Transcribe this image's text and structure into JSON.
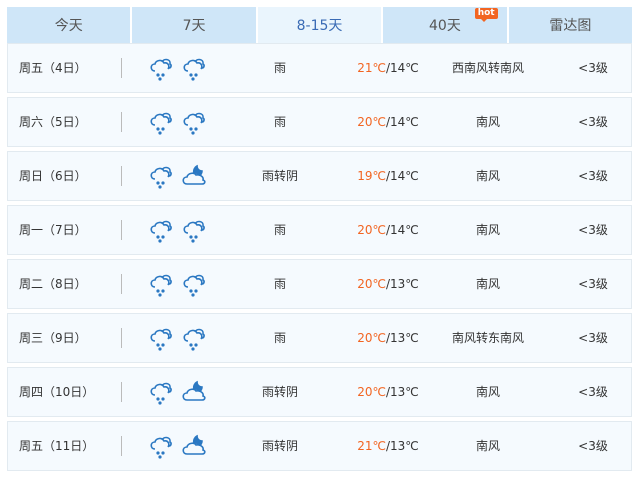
{
  "tabs": [
    {
      "label": "今天"
    },
    {
      "label": "7天"
    },
    {
      "label": "8-15天",
      "active": true
    },
    {
      "label": "40天",
      "badge": "hot"
    },
    {
      "label": "雷达图"
    }
  ],
  "colors": {
    "accent": "#3a6bb5",
    "high_temp": "#f26522",
    "icon": "#2b78c2"
  },
  "days": [
    {
      "date": "周五（4日）",
      "icons": [
        "rain-icon",
        "rain-icon"
      ],
      "weather": "雨",
      "high": "21℃",
      "low": "/14℃",
      "wind": "西南风转南风",
      "level": "<3级"
    },
    {
      "date": "周六（5日）",
      "icons": [
        "rain-icon",
        "rain-icon"
      ],
      "weather": "雨",
      "high": "20℃",
      "low": "/14℃",
      "wind": "南风",
      "level": "<3级"
    },
    {
      "date": "周日（6日）",
      "icons": [
        "rain-icon",
        "cloudy-night-icon"
      ],
      "weather": "雨转阴",
      "high": "19℃",
      "low": "/14℃",
      "wind": "南风",
      "level": "<3级"
    },
    {
      "date": "周一（7日）",
      "icons": [
        "rain-icon",
        "rain-icon"
      ],
      "weather": "雨",
      "high": "20℃",
      "low": "/14℃",
      "wind": "南风",
      "level": "<3级"
    },
    {
      "date": "周二（8日）",
      "icons": [
        "rain-icon",
        "rain-icon"
      ],
      "weather": "雨",
      "high": "20℃",
      "low": "/13℃",
      "wind": "南风",
      "level": "<3级"
    },
    {
      "date": "周三（9日）",
      "icons": [
        "rain-icon",
        "rain-icon"
      ],
      "weather": "雨",
      "high": "20℃",
      "low": "/13℃",
      "wind": "南风转东南风",
      "level": "<3级"
    },
    {
      "date": "周四（10日）",
      "icons": [
        "rain-icon",
        "cloudy-night-icon"
      ],
      "weather": "雨转阴",
      "high": "20℃",
      "low": "/13℃",
      "wind": "南风",
      "level": "<3级"
    },
    {
      "date": "周五（11日）",
      "icons": [
        "rain-icon",
        "cloudy-night-icon"
      ],
      "weather": "雨转阴",
      "high": "21℃",
      "low": "/13℃",
      "wind": "南风",
      "level": "<3级"
    }
  ]
}
